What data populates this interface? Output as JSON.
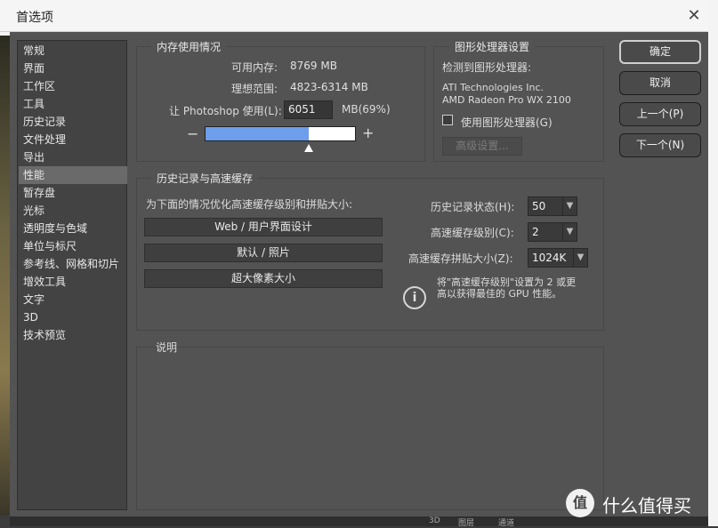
{
  "window": {
    "title": "首选项"
  },
  "sidebar": {
    "items": [
      "常规",
      "界面",
      "工作区",
      "工具",
      "历史记录",
      "文件处理",
      "导出",
      "性能",
      "暂存盘",
      "光标",
      "透明度与色域",
      "单位与标尺",
      "参考线、网格和切片",
      "增效工具",
      "文字",
      "3D",
      "技术预览"
    ],
    "selected_index": 7
  },
  "memory": {
    "title": "内存使用情况",
    "available_label": "可用内存:",
    "available_value": "8769 MB",
    "ideal_label": "理想范围:",
    "ideal_value": "4823-6314 MB",
    "use_label": "让 Photoshop 使用(L):",
    "use_value": "6051",
    "use_unit": "MB(69%)",
    "slider_fraction": 0.69,
    "minus": "−",
    "plus": "+"
  },
  "gpu": {
    "title": "图形处理器设置",
    "detected_label": "检测到图形处理器:",
    "vendor": "ATI Technologies Inc.",
    "model": "AMD Radeon Pro WX 2100",
    "use_gpu_label": "使用图形处理器(G)",
    "use_gpu_checked": false,
    "advanced_label": "高级设置..."
  },
  "history_cache": {
    "title": "历史记录与高速缓存",
    "optimize_label": "为下面的情况优化高速缓存级别和拼贴大小:",
    "buttons": [
      "Web / 用户界面设计",
      "默认 / 照片",
      "超大像素大小"
    ],
    "history_states_label": "历史记录状态(H):",
    "history_states_value": "50",
    "cache_levels_label": "高速缓存级别(C):",
    "cache_levels_value": "2",
    "tile_size_label": "高速缓存拼贴大小(Z):",
    "tile_size_value": "1024K",
    "info_line1": "将\"高速缓存级别\"设置为 2 或更",
    "info_line2": "高以获得最佳的 GPU 性能。"
  },
  "description": {
    "title": "说明"
  },
  "dialog_buttons": {
    "ok": "确定",
    "cancel": "取消",
    "prev": "上一个(P)",
    "next": "下一个(N)"
  },
  "background_strip": {
    "tabs": [
      "3D",
      "图层",
      "通道"
    ]
  },
  "watermark": {
    "text": "什么值得买"
  },
  "colors": {
    "slider_fill": "#6d9eeb",
    "dialog_bg": "#535353",
    "sidebar_bg": "#434343"
  }
}
